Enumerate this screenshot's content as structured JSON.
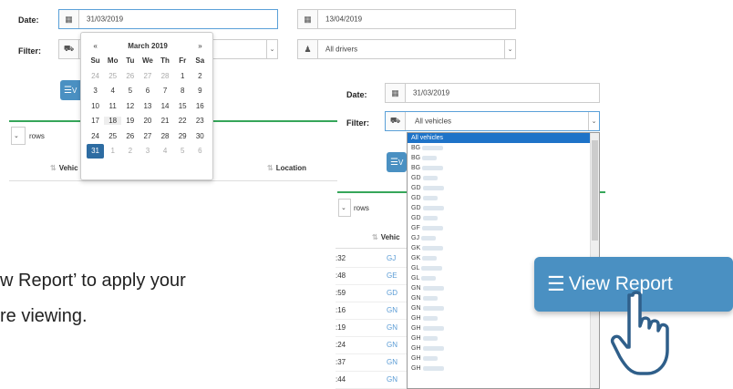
{
  "panel1": {
    "date_label": "Date:",
    "date_from": "31/03/2019",
    "date_to": "13/04/2019",
    "filter_label": "Filter:",
    "drivers_value": "All drivers",
    "rows_label": "rows",
    "col_vehicle": "Vehic",
    "col_location": "Location"
  },
  "calendar": {
    "prev": "«",
    "next": "»",
    "month": "March 2019",
    "days": [
      "Su",
      "Mo",
      "Tu",
      "We",
      "Th",
      "Fr",
      "Sa"
    ],
    "weeks": [
      [
        "24",
        "25",
        "26",
        "27",
        "28",
        "1",
        "2"
      ],
      [
        "3",
        "4",
        "5",
        "6",
        "7",
        "8",
        "9"
      ],
      [
        "10",
        "11",
        "12",
        "13",
        "14",
        "15",
        "16"
      ],
      [
        "17",
        "18",
        "19",
        "20",
        "21",
        "22",
        "23"
      ],
      [
        "24",
        "25",
        "26",
        "27",
        "28",
        "29",
        "30"
      ],
      [
        "31",
        "1",
        "2",
        "3",
        "4",
        "5",
        "6"
      ]
    ]
  },
  "panel2": {
    "date_label": "Date:",
    "date_value": "31/03/2019",
    "filter_label": "Filter:",
    "vehicles_value": "All vehicles",
    "rows_label": "rows",
    "col_vehicle": "Vehic",
    "times": [
      ":32",
      ":48",
      ":59",
      ":16",
      ":19",
      ":24",
      ":37",
      ":44"
    ],
    "vehicle_prefixes": [
      "GJ",
      "GE",
      "GD",
      "GN",
      "GN",
      "GN",
      "GN",
      "GN"
    ]
  },
  "dropdown": {
    "items": [
      "All vehicles",
      "BG",
      "BG",
      "BG",
      "GD",
      "GD",
      "GD",
      "GD",
      "GD",
      "GF",
      "GJ",
      "GK",
      "GK",
      "GL",
      "GL",
      "GN",
      "GN",
      "GN",
      "GH",
      "GH",
      "GH",
      "GH",
      "GH",
      "GH"
    ]
  },
  "instruction": {
    "line1": "w Report’ to apply your",
    "line2": "re viewing."
  },
  "view_report": {
    "label": "View Report",
    "short_label": "V"
  },
  "colors": {
    "button_blue": "#4a90c2",
    "selected_blue": "#2d6ca2",
    "green_rule": "#36a65a"
  }
}
